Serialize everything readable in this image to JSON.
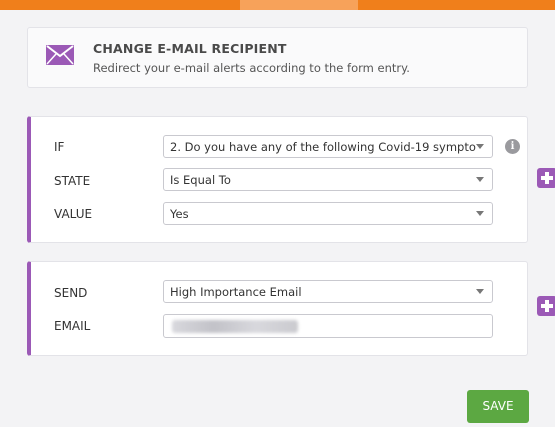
{
  "colors": {
    "top_bar": "#f07f1b",
    "accent_purple": "#9b59b6",
    "save_green": "#5ca842"
  },
  "header": {
    "icon": "envelope-icon",
    "title": "CHANGE E-MAIL RECIPIENT",
    "description": "Redirect your e-mail alerts according to the form entry."
  },
  "condition": {
    "if_label": "IF",
    "if_value": "2. Do you have any of the following Covid-19 sympto",
    "state_label": "STATE",
    "state_value": "Is Equal To",
    "value_label": "VALUE",
    "value_value": "Yes",
    "info_icon": "info-icon",
    "add_icon": "plus-icon"
  },
  "action": {
    "send_label": "SEND",
    "send_value": "High Importance Email",
    "email_label": "EMAIL",
    "email_value": "",
    "add_icon": "plus-icon"
  },
  "footer": {
    "save_label": "SAVE"
  }
}
